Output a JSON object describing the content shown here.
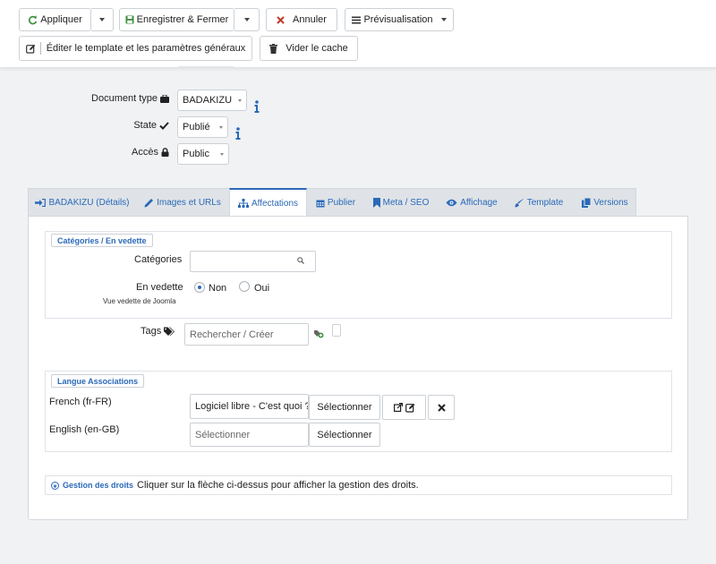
{
  "toolbar": {
    "apply_label": "Appliquer",
    "save_close_label": "Enregistrer & Fermer",
    "cancel_label": "Annuler",
    "preview_label": "Prévisualisation",
    "edit_template_label": "Éditer le template et les paramètres généraux",
    "clear_cache_label": "Vider le cache"
  },
  "fields": {
    "document_type": {
      "label": "Document type",
      "value": "BADAKIZU"
    },
    "state": {
      "label": "State",
      "value": "Publié"
    },
    "access": {
      "label": "Accès",
      "value": "Public"
    }
  },
  "tabs": [
    {
      "label": "BADAKIZU (Détails)",
      "icon": "sign-in-icon"
    },
    {
      "label": "Images et URLs",
      "icon": "pencil-icon"
    },
    {
      "label": "Affectations",
      "icon": "sitemap-icon",
      "active": true
    },
    {
      "label": "Publier",
      "icon": "calendar-icon"
    },
    {
      "label": "Meta / SEO",
      "icon": "bookmark-icon"
    },
    {
      "label": "Affichage",
      "icon": "eye-icon"
    },
    {
      "label": "Template",
      "icon": "brush-icon"
    },
    {
      "label": "Versions",
      "icon": "copy-icon"
    }
  ],
  "categories_section": {
    "legend": "Catégories / En vedette",
    "categories_label": "Catégories",
    "featured_label": "En vedette",
    "featured_sub": "Vue vedette de Joomla",
    "featured_options": [
      "Non",
      "Oui"
    ],
    "featured_selected": "Non"
  },
  "tags": {
    "label": "Tags",
    "placeholder": "Rechercher / Créer"
  },
  "lang_assoc": {
    "legend": "Langue Associations",
    "rows": [
      {
        "lang": "French (fr-FR)",
        "value": "Logiciel libre - C'est quoi ?",
        "select_label": "Sélectionner"
      },
      {
        "lang": "English (en-GB)",
        "placeholder": "Sélectionner",
        "select_label": "Sélectionner"
      }
    ]
  },
  "permissions": {
    "link_label": "Gestion des droits",
    "hint": "Cliquer sur la flèche ci-dessus pour afficher la gestion des droits."
  },
  "colors": {
    "accent": "#2a69b8",
    "apply_icon": "#3c8d3c",
    "cancel_icon": "#c0392b",
    "info_icon": "#2a69b8"
  }
}
